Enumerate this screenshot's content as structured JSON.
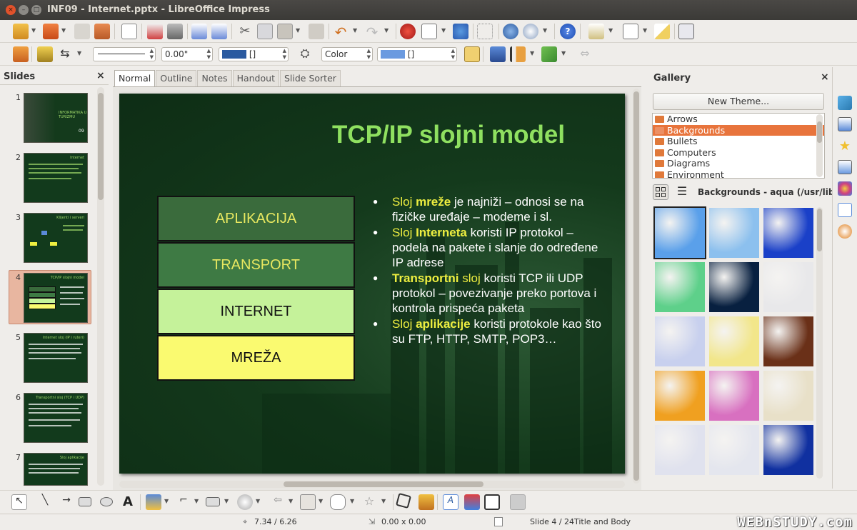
{
  "window": {
    "title": "INF09 - Internet.pptx - LibreOffice Impress",
    "close": "×",
    "minimize": "–",
    "maximize": "□"
  },
  "toolbar2": {
    "line_style": "",
    "line_width": "0.00\"",
    "line_color_value": "[]",
    "area_style": "Color",
    "area_color_value": "[]"
  },
  "slides_panel": {
    "title": "Slides",
    "close": "×",
    "slides": [
      {
        "num": "1",
        "title": "INFORMATIKA U TURIZMU",
        "subtitle": "09"
      },
      {
        "num": "2",
        "title": "Internet"
      },
      {
        "num": "3",
        "title": "Klijenti i serveri"
      },
      {
        "num": "4",
        "title": "TCP/IP slojni model"
      },
      {
        "num": "5",
        "title": "Internet sloj (IP i ruteri)"
      },
      {
        "num": "6",
        "title": "Transportni sloj (TCP i UDP)"
      },
      {
        "num": "7",
        "title": "Sloj aplikacije"
      }
    ],
    "selected": 4
  },
  "view_tabs": [
    "Normal",
    "Outline",
    "Notes",
    "Handout",
    "Slide Sorter"
  ],
  "active_tab": "Normal",
  "slide": {
    "title": "TCP/IP slojni model",
    "layers": [
      {
        "label": "APLIKACIJA",
        "bg": "#3a6b3c",
        "fg": "#e8e860"
      },
      {
        "label": "TRANSPORT",
        "bg": "#3e7a44",
        "fg": "#e8e860"
      },
      {
        "label": "INTERNET",
        "bg": "#c5f29a",
        "fg": "#111111"
      },
      {
        "label": "MREŽA",
        "bg": "#fafa70",
        "fg": "#111111"
      }
    ],
    "bullets": [
      {
        "p1": "Sloj ",
        "b": "mreže",
        "p2": " je najniži – odnosi se na fizičke uređaje – modeme i sl."
      },
      {
        "p1": "Sloj ",
        "b": "Interneta",
        "p2": " koristi IP protokol – podela na pakete i slanje do određene IP adrese"
      },
      {
        "p1": "",
        "b": "Transportni",
        "p1b": " sloj",
        "p2": " koristi TCP ili UDP protokol – povezivanje preko portova i kontrola prispeća paketa"
      },
      {
        "p1": "Sloj ",
        "b": "aplikacije",
        "p2": " koristi protokole kao što su FTP, HTTP, SMTP, POP3…"
      }
    ]
  },
  "gallery": {
    "title": "Gallery",
    "close": "×",
    "new_theme": "New Theme...",
    "themes": [
      "Arrows",
      "Backgrounds",
      "Bullets",
      "Computers",
      "Diagrams",
      "Environment"
    ],
    "selected_theme": "Backgrounds",
    "path": "Backgrounds - aqua (/usr/lib/",
    "swatches": [
      "#5aa0ea",
      "#8cc0ee",
      "#1a40c8",
      "#5ed08a",
      "#082040",
      "#e8e8ea",
      "#c8d0ee",
      "#f2e68a",
      "#6a3018",
      "#f0a020",
      "#d870c0",
      "#e8e0c8",
      "#e0e2ee",
      "#e4e6ee",
      "#1030a0"
    ]
  },
  "status": {
    "position": "7.34 / 6.26",
    "size": "0.00 x 0.00",
    "slide": "Slide 4 / 24",
    "layout": "Title and Body",
    "watermark": "WEBnSTUDY.com"
  },
  "colors": {
    "accent": "#e8743c",
    "slide_title": "#8fe060",
    "highlight": "#eeee40"
  }
}
